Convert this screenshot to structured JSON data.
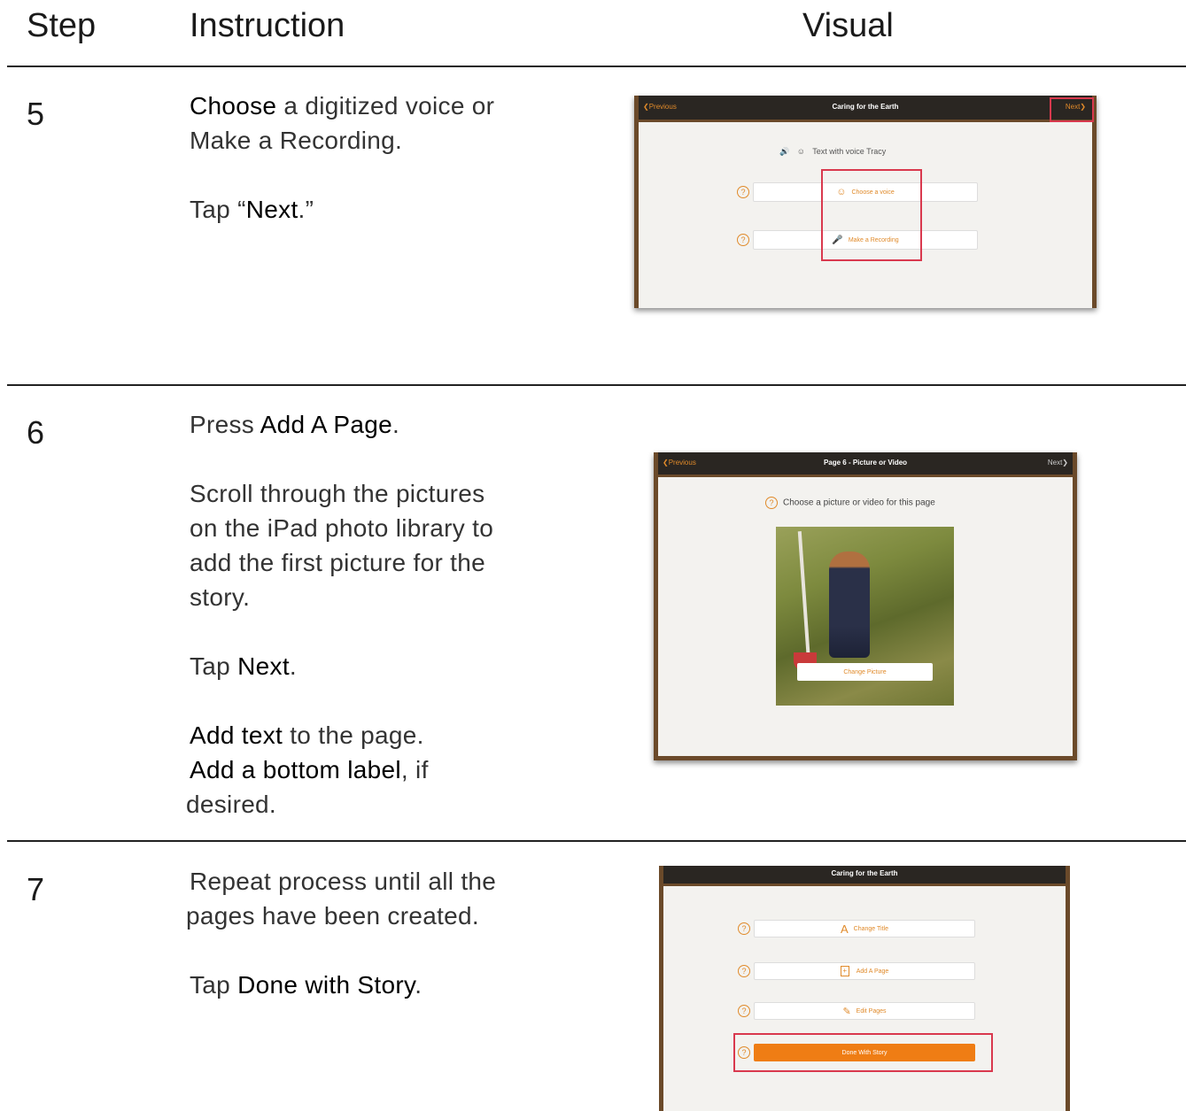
{
  "headers": {
    "step": "Step",
    "instruction": "Instruction",
    "visual": "Visual"
  },
  "rows": [
    {
      "step": "5",
      "lines": [
        {
          "bold": "Choose",
          "rest": " a digitized voice or"
        },
        {
          "text": "Make a Recording."
        },
        {
          "pre": "Tap “",
          "bold": "Next",
          "post": ".”"
        }
      ],
      "screen": {
        "prev": "Previous",
        "title": "Caring for the Earth",
        "next": "Next",
        "voice_text": "Text with voice Tracy",
        "choose_voice": "Choose a voice",
        "make_recording": "Make a Recording"
      }
    },
    {
      "step": "6",
      "lines": [
        {
          "pre": "Press ",
          "bold": "Add A Page",
          "post": "."
        },
        {
          "text": "Scroll through the pictures"
        },
        {
          "text": "on the iPad photo library to"
        },
        {
          "text": "add the first picture for the"
        },
        {
          "text": "story."
        },
        {
          "pre": "Tap ",
          "bold": "Next",
          "post": "."
        },
        {
          "bold": "Add text",
          "rest": " to the page."
        },
        {
          "bold": "Add a bottom label",
          "rest": ", if"
        },
        {
          "text": "desired."
        }
      ],
      "screen": {
        "prev": "Previous",
        "title": "Page 6 - Picture or Video",
        "next": "Next",
        "prompt": "Choose a picture or video for this page",
        "change_picture": "Change Picture"
      }
    },
    {
      "step": "7",
      "lines": [
        {
          "text": "Repeat process until all the"
        },
        {
          "text": "pages have been created."
        },
        {
          "pre": "Tap ",
          "bold": "Done with Story",
          "post": "."
        }
      ],
      "screen": {
        "title": "Caring for the Earth",
        "change_title": "Change Title",
        "add_page": "Add A Page",
        "edit_pages": "Edit Pages",
        "done": "Done With Story"
      }
    }
  ],
  "colors": {
    "accent": "#e08a2a",
    "highlight": "#d9394e",
    "toolbar": "#2a2622",
    "wood": "#6b4a2a"
  }
}
